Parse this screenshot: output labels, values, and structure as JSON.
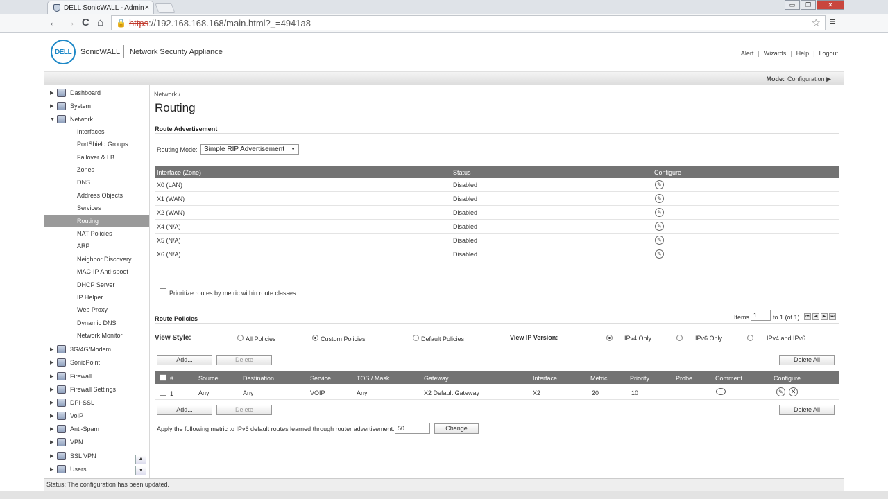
{
  "browser": {
    "tab_title": "DELL SonicWALL - Admin",
    "tab_close": "×",
    "url_scheme": "https",
    "url_rest": "://192.168.168.168/main.html?_=4941a8",
    "back": "←",
    "forward": "→",
    "reload": "C",
    "home": "⌂",
    "star": "☆",
    "menu": "≡",
    "minimize": "▭",
    "restore": "❐",
    "close": "✕"
  },
  "header": {
    "logo_text": "DELL",
    "brand": "SonicWALL",
    "product": "Network Security Appliance",
    "links": [
      "Alert",
      "Wizards",
      "Help",
      "Logout"
    ],
    "mode_label": "Mode:",
    "mode_value": "Configuration ▶"
  },
  "sidebar": {
    "top_items": [
      {
        "label": "Dashboard",
        "arrow": "▶"
      },
      {
        "label": "System",
        "arrow": "▶"
      },
      {
        "label": "Network",
        "arrow": "▼"
      }
    ],
    "network_children": [
      "Interfaces",
      "PortShield Groups",
      "Failover & LB",
      "Zones",
      "DNS",
      "Address Objects",
      "Services",
      "Routing",
      "NAT Policies",
      "ARP",
      "Neighbor Discovery",
      "MAC-IP Anti-spoof",
      "DHCP Server",
      "IP Helper",
      "Web Proxy",
      "Dynamic DNS",
      "Network Monitor"
    ],
    "active_child": "Routing",
    "bottom_items": [
      {
        "label": "3G/4G/Modem",
        "arrow": "▶"
      },
      {
        "label": "SonicPoint",
        "arrow": "▶"
      },
      {
        "label": "Firewall",
        "arrow": "▶"
      },
      {
        "label": "Firewall Settings",
        "arrow": "▶"
      },
      {
        "label": "DPI-SSL",
        "arrow": "▶"
      },
      {
        "label": "VoIP",
        "arrow": "▶"
      },
      {
        "label": "Anti-Spam",
        "arrow": "▶"
      },
      {
        "label": "VPN",
        "arrow": "▶"
      },
      {
        "label": "SSL VPN",
        "arrow": "▶"
      },
      {
        "label": "Users",
        "arrow": "▶"
      }
    ],
    "scroll_up": "▲",
    "scroll_down": "▼"
  },
  "main": {
    "breadcrumb": "Network /",
    "title": "Routing",
    "route_adv": {
      "section_title": "Route Advertisement",
      "mode_label": "Routing Mode:",
      "mode_value": "Simple RIP Advertisement",
      "mode_caret": "▼",
      "columns": [
        "Interface (Zone)",
        "Status",
        "Configure"
      ],
      "rows": [
        {
          "interface": "X0 (LAN)",
          "status": "Disabled"
        },
        {
          "interface": "X1 (WAN)",
          "status": "Disabled"
        },
        {
          "interface": "X2 (WAN)",
          "status": "Disabled"
        },
        {
          "interface": "X4 (N/A)",
          "status": "Disabled"
        },
        {
          "interface": "X5 (N/A)",
          "status": "Disabled"
        },
        {
          "interface": "X6 (N/A)",
          "status": "Disabled"
        }
      ],
      "edit_glyph": "✎",
      "prioritize_label": "Prioritize routes by metric within route classes"
    },
    "route_policies": {
      "section_title": "Route Policies",
      "items_label": "Items",
      "items_value": "1",
      "items_range": "to 1 (of 1)",
      "pager": [
        "⏮",
        "◀",
        "▶",
        "⏭"
      ],
      "view_style_label": "View Style:",
      "view_styles": [
        "All Policies",
        "Custom Policies",
        "Default Policies"
      ],
      "view_style_selected": "Custom Policies",
      "ip_version_label": "View IP Version:",
      "ip_versions": [
        "IPv4 Only",
        "IPv6 Only",
        "IPv4 and IPv6"
      ],
      "ip_version_selected": "IPv4 Only",
      "add_label": "Add...",
      "delete_label": "Delete",
      "delete_all_label": "Delete All",
      "columns": [
        "#",
        "Source",
        "Destination",
        "Service",
        "TOS / Mask",
        "Gateway",
        "Interface",
        "Metric",
        "Priority",
        "Probe",
        "Comment",
        "Configure"
      ],
      "rows": [
        {
          "num": "1",
          "source": "Any",
          "destination": "Any",
          "service": "VOIP",
          "tos": "Any",
          "gateway": "X2 Default Gateway",
          "interface": "X2",
          "metric": "20",
          "priority": "10",
          "probe": ""
        }
      ],
      "delete_glyph": "✕",
      "ipv6_metric_label": "Apply the following metric to IPv6 default routes learned through router advertisement:",
      "ipv6_metric_value": "50",
      "change_label": "Change"
    }
  },
  "status": {
    "text": "Status: The configuration has been updated."
  }
}
